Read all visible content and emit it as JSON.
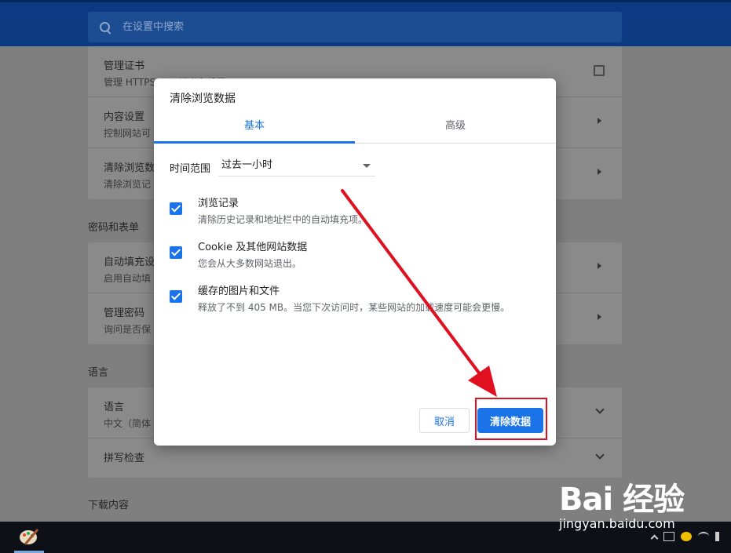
{
  "search": {
    "placeholder": "在设置中搜索"
  },
  "background": {
    "card1": [
      {
        "title": "管理证书",
        "subtitle": "管理 HTTPS/SSL 证书和设置"
      },
      {
        "title": "内容设置",
        "subtitle": "控制网站可"
      },
      {
        "title": "清除浏览数",
        "subtitle": "清除浏览记"
      }
    ],
    "section_passwords": "密码和表单",
    "card2": [
      {
        "title": "自动填充设",
        "subtitle": "启用自动填"
      },
      {
        "title": "管理密码",
        "subtitle": "询问是否保"
      }
    ],
    "section_language": "语言",
    "card3": [
      {
        "title": "语言",
        "subtitle": "中文（简体"
      },
      {
        "title": "拼写检查",
        "subtitle": ""
      }
    ],
    "section_downloads": "下载内容"
  },
  "dialog": {
    "title": "清除浏览数据",
    "tabs": [
      {
        "label": "基本",
        "active": true
      },
      {
        "label": "高级",
        "active": false
      }
    ],
    "time_range_label": "时间范围",
    "time_range_value": "过去一小时",
    "options": [
      {
        "title": "浏览记录",
        "subtitle": "清除历史记录和地址栏中的自动填充项。",
        "checked": true
      },
      {
        "title": "Cookie 及其他网站数据",
        "subtitle": "您会从大多数网站退出。",
        "checked": true
      },
      {
        "title": "缓存的图片和文件",
        "subtitle": "释放了不到 405 MB。当您下次访问时，某些网站的加载速度可能会更慢。",
        "checked": true
      }
    ],
    "cancel_label": "取消",
    "clear_label": "清除数据"
  },
  "watermark": {
    "logo": "Bai 经验",
    "url": "jingyan.baidu.com"
  },
  "colors": {
    "accent": "#1a73e8",
    "header": "#0b3a82",
    "annotation": "#e01020"
  }
}
